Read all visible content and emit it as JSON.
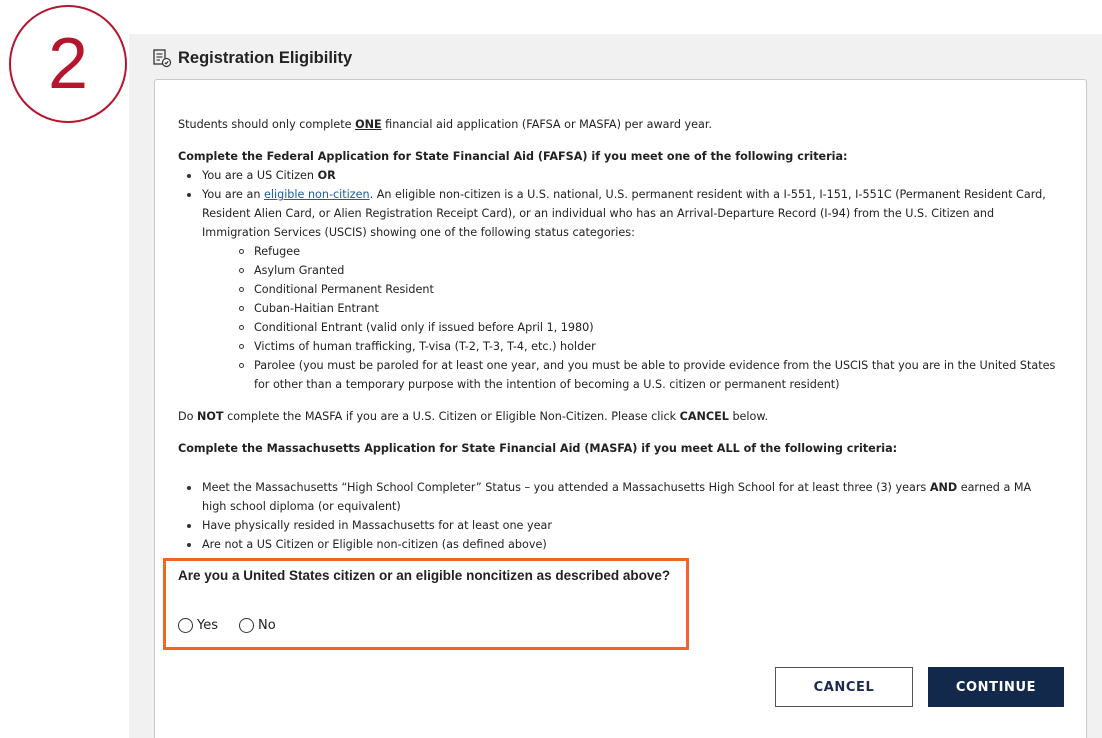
{
  "step_number": "2",
  "section": {
    "title": "Registration Eligibility",
    "icon": "document-check-icon"
  },
  "intro": {
    "pre": "Students should only complete ",
    "emph": "ONE",
    "post": " financial aid application (FAFSA or MASFA) per award year."
  },
  "fafsa": {
    "heading": "Complete the Federal Application for State Financial Aid (FAFSA) if you meet one of the following criteria:",
    "item1_text": "You are a US Citizen ",
    "item1_bold": "OR",
    "item2_pre": "You are an ",
    "item2_link": "eligible non-citizen",
    "item2_post": ".  An eligible non-citizen is a U.S. national, U.S. permanent resident with a I-551, I-151, I-551C (Permanent Resident Card, Resident Alien Card, or Alien Registration Receipt Card), or an individual who has an Arrival-Departure Record (I-94) from the U.S. Citizen and Immigration Services (USCIS) showing one of the following status categories:",
    "statuses": [
      "Refugee",
      "Asylum Granted",
      "Conditional Permanent Resident",
      "Cuban-Haitian Entrant",
      "Conditional Entrant (valid only if issued before April 1, 1980)",
      "Victims of human trafficking, T-visa (T-2, T-3, T-4, etc.) holder",
      "Parolee (you must be paroled for at least one year, and you must be able to provide evidence from the USCIS that you are in the United States for other than a temporary purpose with the intention of becoming a U.S. citizen or permanent resident)"
    ]
  },
  "notice": {
    "pre": "Do ",
    "not": "NOT",
    "mid": " complete the MASFA if you are a U.S. Citizen or Eligible Non-Citizen.  Please click ",
    "cancel": "CANCEL",
    "post": " below."
  },
  "masfa": {
    "heading": "Complete the Massachusetts Application for State Financial Aid (MASFA) if you meet ALL of the following criteria:",
    "item1_pre": "Meet the Massachusetts “High School Completer” Status – you attended a Massachusetts High School for at least three (3) years ",
    "item1_bold": "AND",
    "item1_post": " earned a MA high school diploma (or equivalent)",
    "item2": "Have physically resided in Massachusetts for at least one year",
    "item3": "Are not a US Citizen or Eligible non-citizen (as defined above)"
  },
  "question": {
    "text": "Are you a United States citizen or an eligible noncitizen as described above?",
    "yes_label": "Yes",
    "no_label": "No",
    "selected": ""
  },
  "buttons": {
    "cancel": "CANCEL",
    "continue": "CONTINUE"
  },
  "colors": {
    "step_accent": "#b5162e",
    "highlight_border": "#f26522",
    "primary_button": "#13294b",
    "link": "#1f5c99"
  }
}
